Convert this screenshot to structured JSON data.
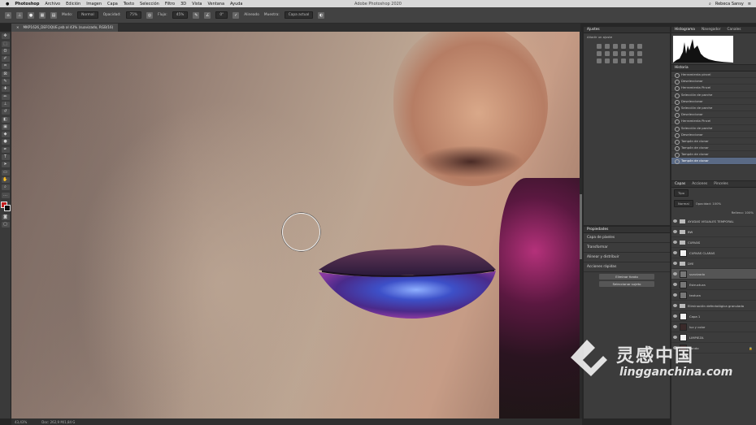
{
  "macbar": {
    "app": "Photoshop",
    "menus": [
      "Archivo",
      "Edición",
      "Imagen",
      "Capa",
      "Texto",
      "Selección",
      "Filtro",
      "3D",
      "Vista",
      "Ventana",
      "Ayuda"
    ],
    "window_title": "Adobe Photoshop 2020",
    "user": "Rebeca Sansy"
  },
  "options": {
    "mode_label": "Modo:",
    "mode_value": "Normal",
    "opacity_label": "Opacidad:",
    "opacity_value": "75%",
    "flow_label": "Flujo:",
    "flow_value": "45%",
    "angle_value": "0°",
    "aligned_label": "Alineado",
    "sample_label": "Muestra:",
    "sample_value": "Capa actual"
  },
  "document_tab": {
    "title": "MKP1626_DEFOQUE.psb al 43% (suavizado, RGB/16)",
    "close": "×"
  },
  "status": {
    "zoom": "43,43%",
    "doc": "Doc: 262,9 M/1,84 G"
  },
  "panels": {
    "adjustments": {
      "title": "Ajustes",
      "hint": "Añadir un ajuste"
    },
    "properties": {
      "title": "Propiedades",
      "type": "Capa de píxeles",
      "transform": "Transformar",
      "align": "Alinear y distribuir",
      "quick": "Acciones rápidas",
      "btn1": "Eliminar fondo",
      "btn2": "Seleccionar sujeto"
    },
    "histogram": {
      "tabs": [
        "Histograma",
        "Navegador",
        "Canales"
      ]
    },
    "history": {
      "title": "Historia",
      "items": [
        "Herramienta pincel",
        "Deseleccionar",
        "Herramienta Pincel",
        "Selección de parche",
        "Deseleccionar",
        "Selección de parche",
        "Deseleccionar",
        "Herramienta Pincel",
        "Selección de parche",
        "Deseleccionar",
        "Tampón de clonar",
        "Tampón de clonar",
        "Tampón de clonar",
        "Tampón de clonar"
      ]
    },
    "layers": {
      "tabs": [
        "Capas",
        "Acciones",
        "Pinceles"
      ],
      "search": "Tipo",
      "blend": "Normal",
      "opacity": "Opacidad: 100%",
      "fill": "Relleno: 100%",
      "rows": [
        "AYUDAS VISUALES TEMPORAL",
        "BW",
        "CURVAS",
        "CURVAS CLARAS",
        "DYE",
        "suavizado",
        "Estructura",
        "textura",
        "Eliminación defectológica granulada",
        "Capa 1",
        "luz y color",
        "LIMPIEZA",
        "Fondo"
      ]
    }
  },
  "watermark": {
    "cn": "灵感中国",
    "site": "lingganchina.com"
  }
}
